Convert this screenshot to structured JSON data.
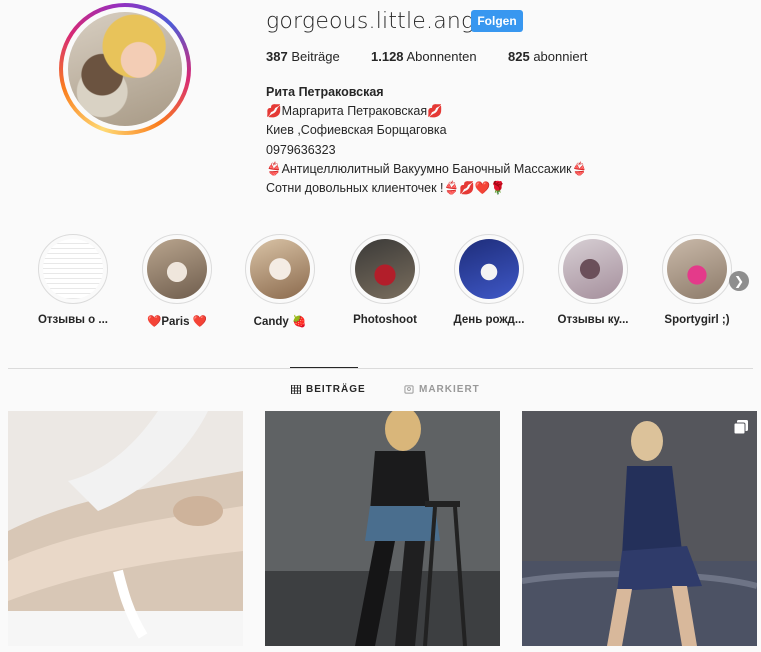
{
  "profile": {
    "username": "gorgeous.little.angel",
    "follow_label": "Folgen",
    "stats": {
      "posts_count": "387",
      "posts_label": "Beiträge",
      "followers_count": "1.128",
      "followers_label": "Abonnenten",
      "following_count": "825",
      "following_label": "abonniert"
    },
    "full_name": "Рита Петраковская",
    "bio_lines": [
      "💋Маргарита Петраковская💋",
      "Киев ,Софиевская Борщаговка",
      "0979636323",
      "👙Антицеллюлитный Вакуумно Баночный Массажик👙",
      "Сотни довольных клиенточек !👙💋❤️🌹"
    ]
  },
  "highlights": [
    {
      "label": "Отзывы о ..."
    },
    {
      "label": "❤️Paris ❤️"
    },
    {
      "label": "Candy 🍓"
    },
    {
      "label": "Photoshoot"
    },
    {
      "label": "День рожд..."
    },
    {
      "label": "Отзывы ку..."
    },
    {
      "label": "Sportygirl ;)"
    }
  ],
  "tabs": {
    "posts": "BEITRÄGE",
    "tagged": "MARKIERT"
  },
  "icons": {
    "next": "chevron-right-icon",
    "posts_tab": "grid-icon",
    "tagged_tab": "tag-icon",
    "multi": "multiple-images-icon"
  },
  "colors": {
    "accent": "#3897f0",
    "text": "#262626",
    "muted": "#999999"
  }
}
